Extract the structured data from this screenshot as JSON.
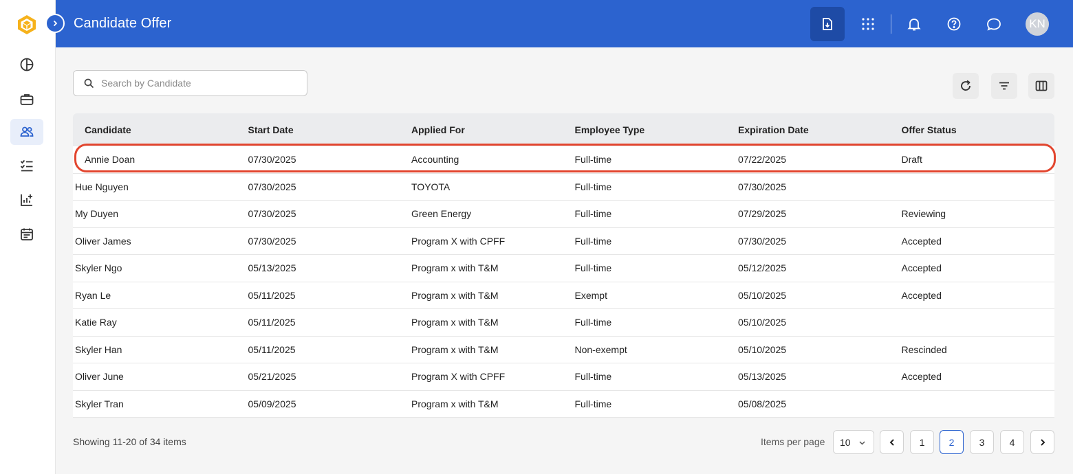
{
  "header": {
    "title": "Candidate Offer",
    "avatar_initials": "KN"
  },
  "icons": {
    "logo": "hexagon-cube-icon",
    "expand": "chevron-right-icon",
    "header_buttons": [
      "import-document-icon",
      "app-grid-icon",
      "bell-icon",
      "help-circle-icon",
      "chat-icon"
    ],
    "sidebar": [
      "dashboard-pie-icon",
      "briefcase-icon",
      "people-icon",
      "checklist-icon",
      "analytics-icon",
      "calendar-icon"
    ],
    "toolbar": [
      "refresh-icon",
      "filter-icon",
      "columns-icon"
    ]
  },
  "colors": {
    "header_bg": "#2c63cf",
    "highlight": "#e2452e",
    "active_page": "#2c63cf"
  },
  "search": {
    "placeholder": "Search by Candidate",
    "value": ""
  },
  "table": {
    "columns": [
      "Candidate",
      "Start Date",
      "Applied For",
      "Employee Type",
      "Expiration Date",
      "Offer Status"
    ],
    "rows": [
      [
        "Annie Doan",
        "07/30/2025",
        "Accounting",
        "Full-time",
        "07/22/2025",
        "Draft"
      ],
      [
        "Hue Nguyen",
        "07/30/2025",
        "TOYOTA",
        "Full-time",
        "07/30/2025",
        ""
      ],
      [
        "My Duyen",
        "07/30/2025",
        "Green Energy",
        "Full-time",
        "07/29/2025",
        "Reviewing"
      ],
      [
        "Oliver James",
        "07/30/2025",
        "Program X with CPFF",
        "Full-time",
        "07/30/2025",
        "Accepted"
      ],
      [
        "Skyler Ngo",
        "05/13/2025",
        "Program x with T&M",
        "Full-time",
        "05/12/2025",
        "Accepted"
      ],
      [
        "Ryan Le",
        "05/11/2025",
        "Program x with T&M",
        "Exempt",
        "05/10/2025",
        "Accepted"
      ],
      [
        "Katie Ray",
        "05/11/2025",
        "Program x with T&M",
        "Full-time",
        "05/10/2025",
        ""
      ],
      [
        "Skyler Han",
        "05/11/2025",
        "Program x with T&M",
        "Non-exempt",
        "05/10/2025",
        "Rescinded"
      ],
      [
        "Oliver June",
        "05/21/2025",
        "Program X with CPFF",
        "Full-time",
        "05/13/2025",
        "Accepted"
      ],
      [
        "Skyler Tran",
        "05/09/2025",
        "Program x with T&M",
        "Full-time",
        "05/08/2025",
        ""
      ]
    ]
  },
  "footer": {
    "showing": "Showing 11-20 of 34 items",
    "items_per_page_label": "Items per page",
    "items_per_page": "10",
    "pages": [
      "1",
      "2",
      "3",
      "4"
    ],
    "current_page": "2"
  }
}
